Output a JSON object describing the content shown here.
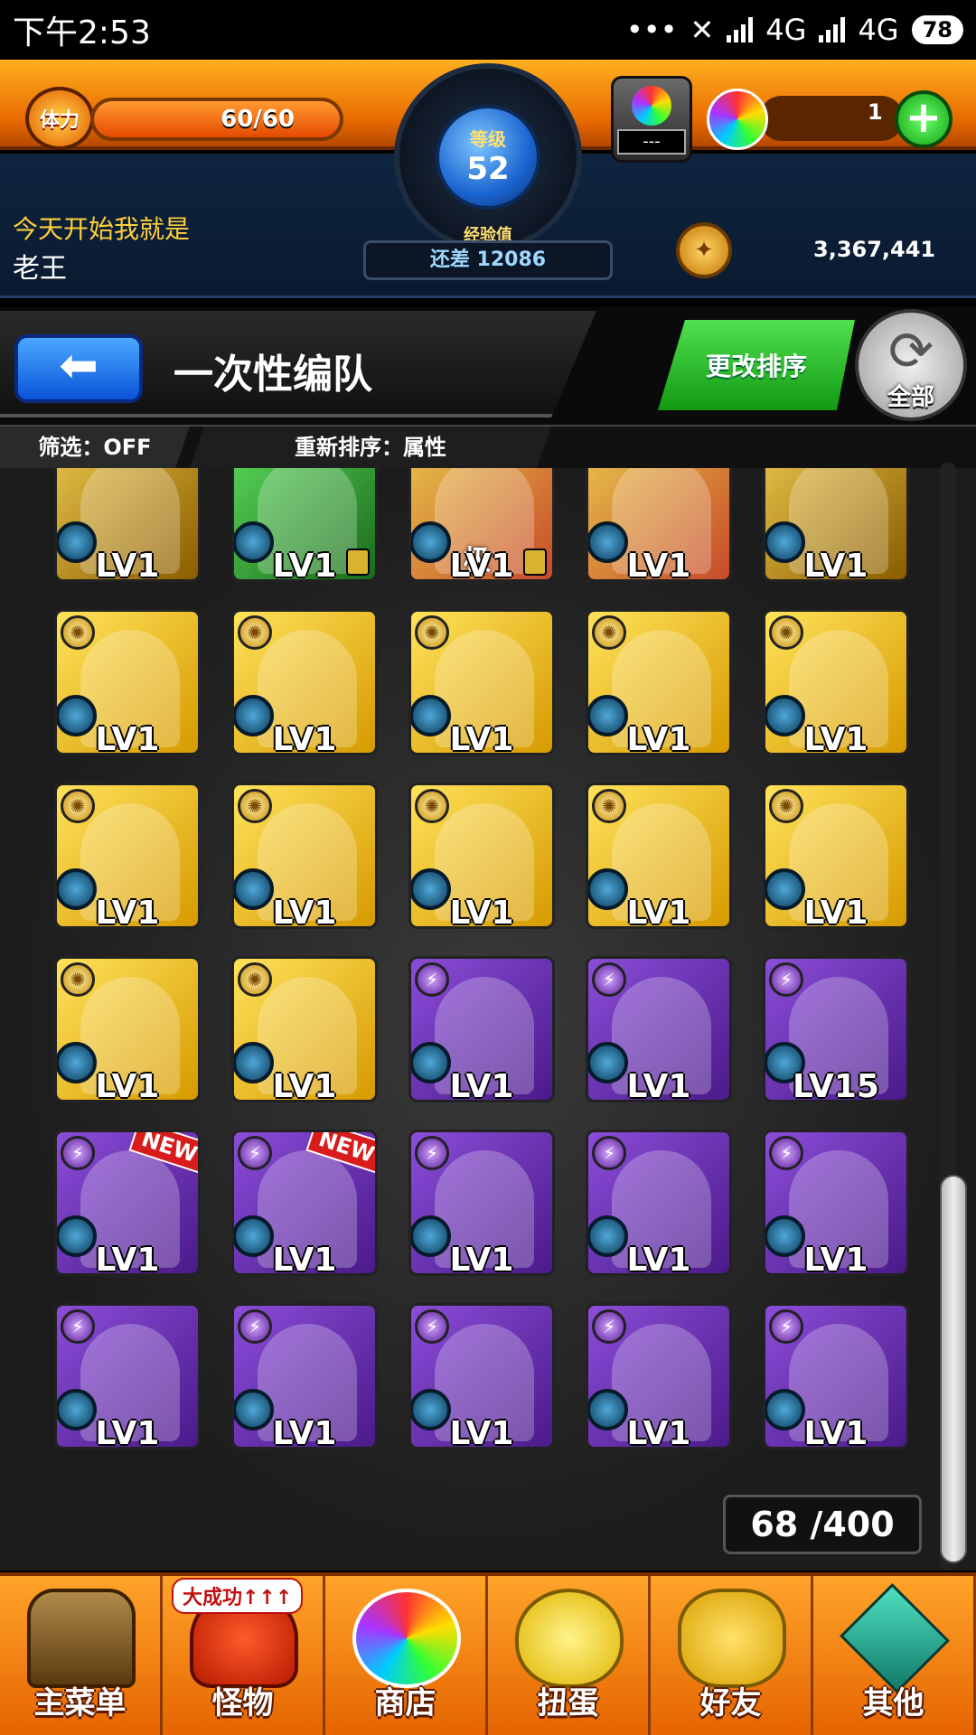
{
  "status_bar": {
    "time": "下午2:53",
    "network_1": "4G",
    "network_2": "4G",
    "battery": "78"
  },
  "header": {
    "stamina_label": "体力",
    "stamina_text": "60/60",
    "stamina_fraction": 1.0,
    "level_label": "等级",
    "level_value": "52",
    "exp_label": "经验值",
    "exp_remaining": "还差 12086",
    "gacha_value": "---",
    "orb_count": "1",
    "player_title": "今天开始我就是",
    "player_name": "老王",
    "coin_amount": "3,367,441"
  },
  "titlebar": {
    "title": "一次性编队",
    "sort_change": "更改排序",
    "all_label": "全部",
    "filter": "筛选：OFF",
    "sort_key": "重新排序：属性"
  },
  "grid": [
    {
      "level": "LV1",
      "color": "gold-dark",
      "element": "none"
    },
    {
      "level": "LV1",
      "color": "green",
      "element": "none",
      "lock": true
    },
    {
      "level": "LV1",
      "color": "mixed",
      "element": "none",
      "lock": true,
      "kanji": "极"
    },
    {
      "level": "LV1",
      "color": "mixed",
      "element": "none"
    },
    {
      "level": "LV1",
      "color": "gold-dark",
      "element": "none"
    },
    {
      "level": "LV1",
      "color": "gold",
      "element": "light"
    },
    {
      "level": "LV1",
      "color": "gold",
      "element": "light"
    },
    {
      "level": "LV1",
      "color": "gold",
      "element": "light"
    },
    {
      "level": "LV1",
      "color": "gold",
      "element": "light"
    },
    {
      "level": "LV1",
      "color": "gold",
      "element": "light"
    },
    {
      "level": "LV1",
      "color": "gold",
      "element": "light"
    },
    {
      "level": "LV1",
      "color": "gold",
      "element": "light"
    },
    {
      "level": "LV1",
      "color": "gold",
      "element": "light"
    },
    {
      "level": "LV1",
      "color": "gold",
      "element": "light"
    },
    {
      "level": "LV1",
      "color": "gold",
      "element": "light"
    },
    {
      "level": "LV1",
      "color": "gold",
      "element": "light"
    },
    {
      "level": "LV1",
      "color": "gold",
      "element": "light"
    },
    {
      "level": "LV1",
      "color": "purple",
      "element": "dark"
    },
    {
      "level": "LV1",
      "color": "purple",
      "element": "dark"
    },
    {
      "level": "LV15",
      "color": "purple",
      "element": "dark"
    },
    {
      "level": "LV1",
      "color": "purple",
      "element": "dark",
      "new": "NEW"
    },
    {
      "level": "LV1",
      "color": "purple",
      "element": "dark",
      "new": "NEW"
    },
    {
      "level": "LV1",
      "color": "purple",
      "element": "dark"
    },
    {
      "level": "LV1",
      "color": "purple",
      "element": "dark"
    },
    {
      "level": "LV1",
      "color": "purple",
      "element": "dark"
    },
    {
      "level": "LV1",
      "color": "purple",
      "element": "dark"
    },
    {
      "level": "LV1",
      "color": "purple",
      "element": "dark"
    },
    {
      "level": "LV1",
      "color": "purple",
      "element": "dark"
    },
    {
      "level": "LV1",
      "color": "purple",
      "element": "dark"
    },
    {
      "level": "LV1",
      "color": "purple",
      "element": "dark"
    }
  ],
  "box_count": "68 /400",
  "bottom_nav": [
    {
      "label": "主菜单",
      "icon": "gate-icon"
    },
    {
      "label": "怪物",
      "icon": "monster-icon"
    },
    {
      "label": "商店",
      "icon": "orb-icon"
    },
    {
      "label": "扭蛋",
      "icon": "egg-icon"
    },
    {
      "label": "好友",
      "icon": "friends-icon"
    },
    {
      "label": "其他",
      "icon": "other-icon"
    }
  ],
  "monster_badge": "大成功↑↑↑"
}
